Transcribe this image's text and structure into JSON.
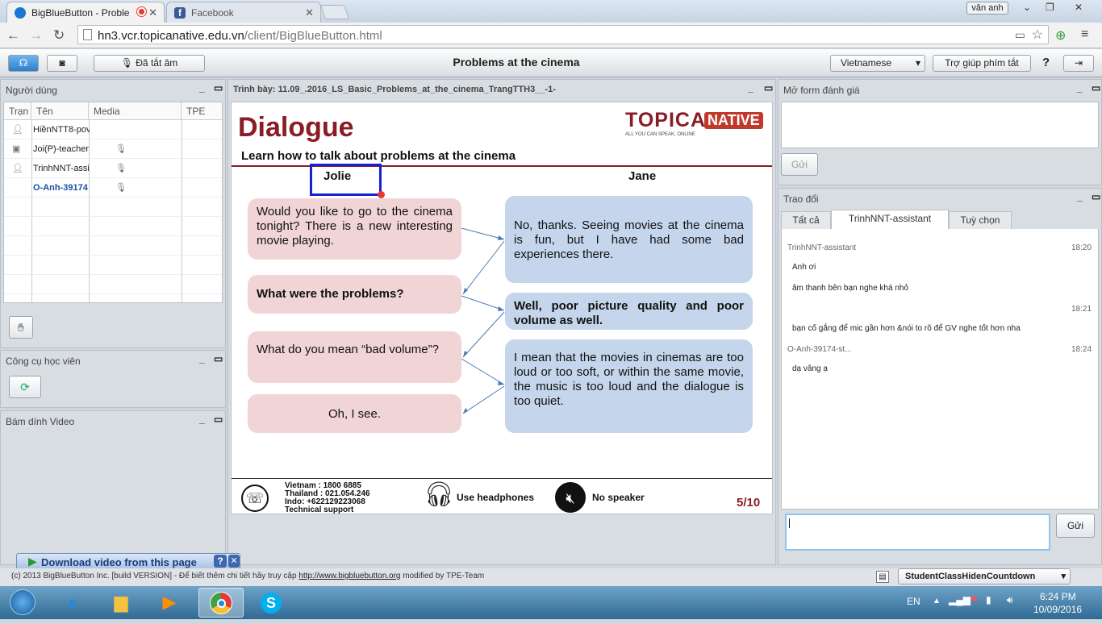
{
  "browser": {
    "tabs": [
      {
        "title": "BigBlueButton - Proble",
        "active": true
      },
      {
        "title": "Facebook",
        "active": false
      }
    ],
    "user_badge": "vân anh",
    "url_host": "hn3.vcr.topicanative.edu.vn",
    "url_path": "/client/BigBlueButton.html"
  },
  "toolbar": {
    "mute_label": "Đã tắt âm",
    "title": "Problems at the cinema",
    "language": "Vietnamese",
    "shortcuts_label": "Trợ giúp phím tắt",
    "help_label": "?"
  },
  "users": {
    "title": "Người dùng",
    "columns": [
      "Trạn",
      "Tên",
      "Media",
      "TPE"
    ],
    "rows": [
      {
        "name": "HiềnNTT8-pov"
      },
      {
        "name": "Joi(P)-teacher"
      },
      {
        "name": "TrinhNNT-assi"
      },
      {
        "name": "O-Anh-39174"
      }
    ]
  },
  "tools": {
    "title": "Công cụ học viên"
  },
  "video": {
    "title": "Bám dính Video"
  },
  "presentation": {
    "title": "Trình bày: 11.09_.2016_LS_Basic_Problems_at_the_cinema_TrangTTH3__-1-",
    "slide": {
      "heading": "Dialogue",
      "subtitle": "Learn how to talk about problems at the cinema",
      "logo_main": "TOPICA",
      "logo_tag": "NATIVE",
      "logo_slogan": "ALL YOU CAN SPEAK, ONLINE",
      "speaker_left": "Jolie",
      "speaker_right": "Jane",
      "left_bubbles": [
        "Would you like to go to the cinema tonight? There is a new interesting movie playing.",
        "What were the problems?",
        "What do you mean “bad volume”?",
        "Oh, I see."
      ],
      "right_bubbles": [
        "No, thanks. Seeing movies at the cinema is fun, but I have had some bad experiences there.",
        "Well, poor picture quality and poor volume as well.",
        "I mean that the movies in cinemas are too loud or too soft, or within the same movie, the music is too loud and the dialogue is too quiet."
      ],
      "support": {
        "vietnam": "Vietnam :  1800 6885",
        "thailand": "Thailand :  021.054.246",
        "indo": "Indo:    +622129223068",
        "label": "Technical support"
      },
      "headphones": "Use headphones",
      "no_speaker": "No speaker",
      "page": "5/10"
    }
  },
  "evaluation": {
    "title": "Mở form đánh giá",
    "send_label": "Gửi"
  },
  "chat": {
    "title": "Trao đổi",
    "tabs": [
      "Tất cả",
      "TrinhNNT-assistant",
      "Tuỳ chọn"
    ],
    "messages": [
      {
        "sender": "TrinhNNT-assistant",
        "time": "18:20",
        "lines": [
          "Anh ơi",
          "âm thanh bên bạn nghe khá nhỏ"
        ]
      },
      {
        "sender": "",
        "time": "18:21",
        "lines": [
          "bạn cố gắng để mic gần hơn &nói to rõ để GV nghe tốt hơn nha"
        ]
      },
      {
        "sender": "O-Anh-39174-st...",
        "time": "18:24",
        "lines": [
          "dạ vâng ạ"
        ]
      }
    ],
    "send_label": "Gửi"
  },
  "footer": {
    "text": "(c) 2013 BigBlueButton Inc. [build VERSION] - Để biết thêm chi tiết hãy truy cập",
    "link": "http://www.bigbluebutton.org",
    "suffix": "modified by TPE-Team",
    "layout": "StudentClassHidenCountdown",
    "download": "Download video from this page"
  },
  "taskbar": {
    "lang": "EN",
    "time": "6:24 PM",
    "date": "10/09/2016"
  }
}
